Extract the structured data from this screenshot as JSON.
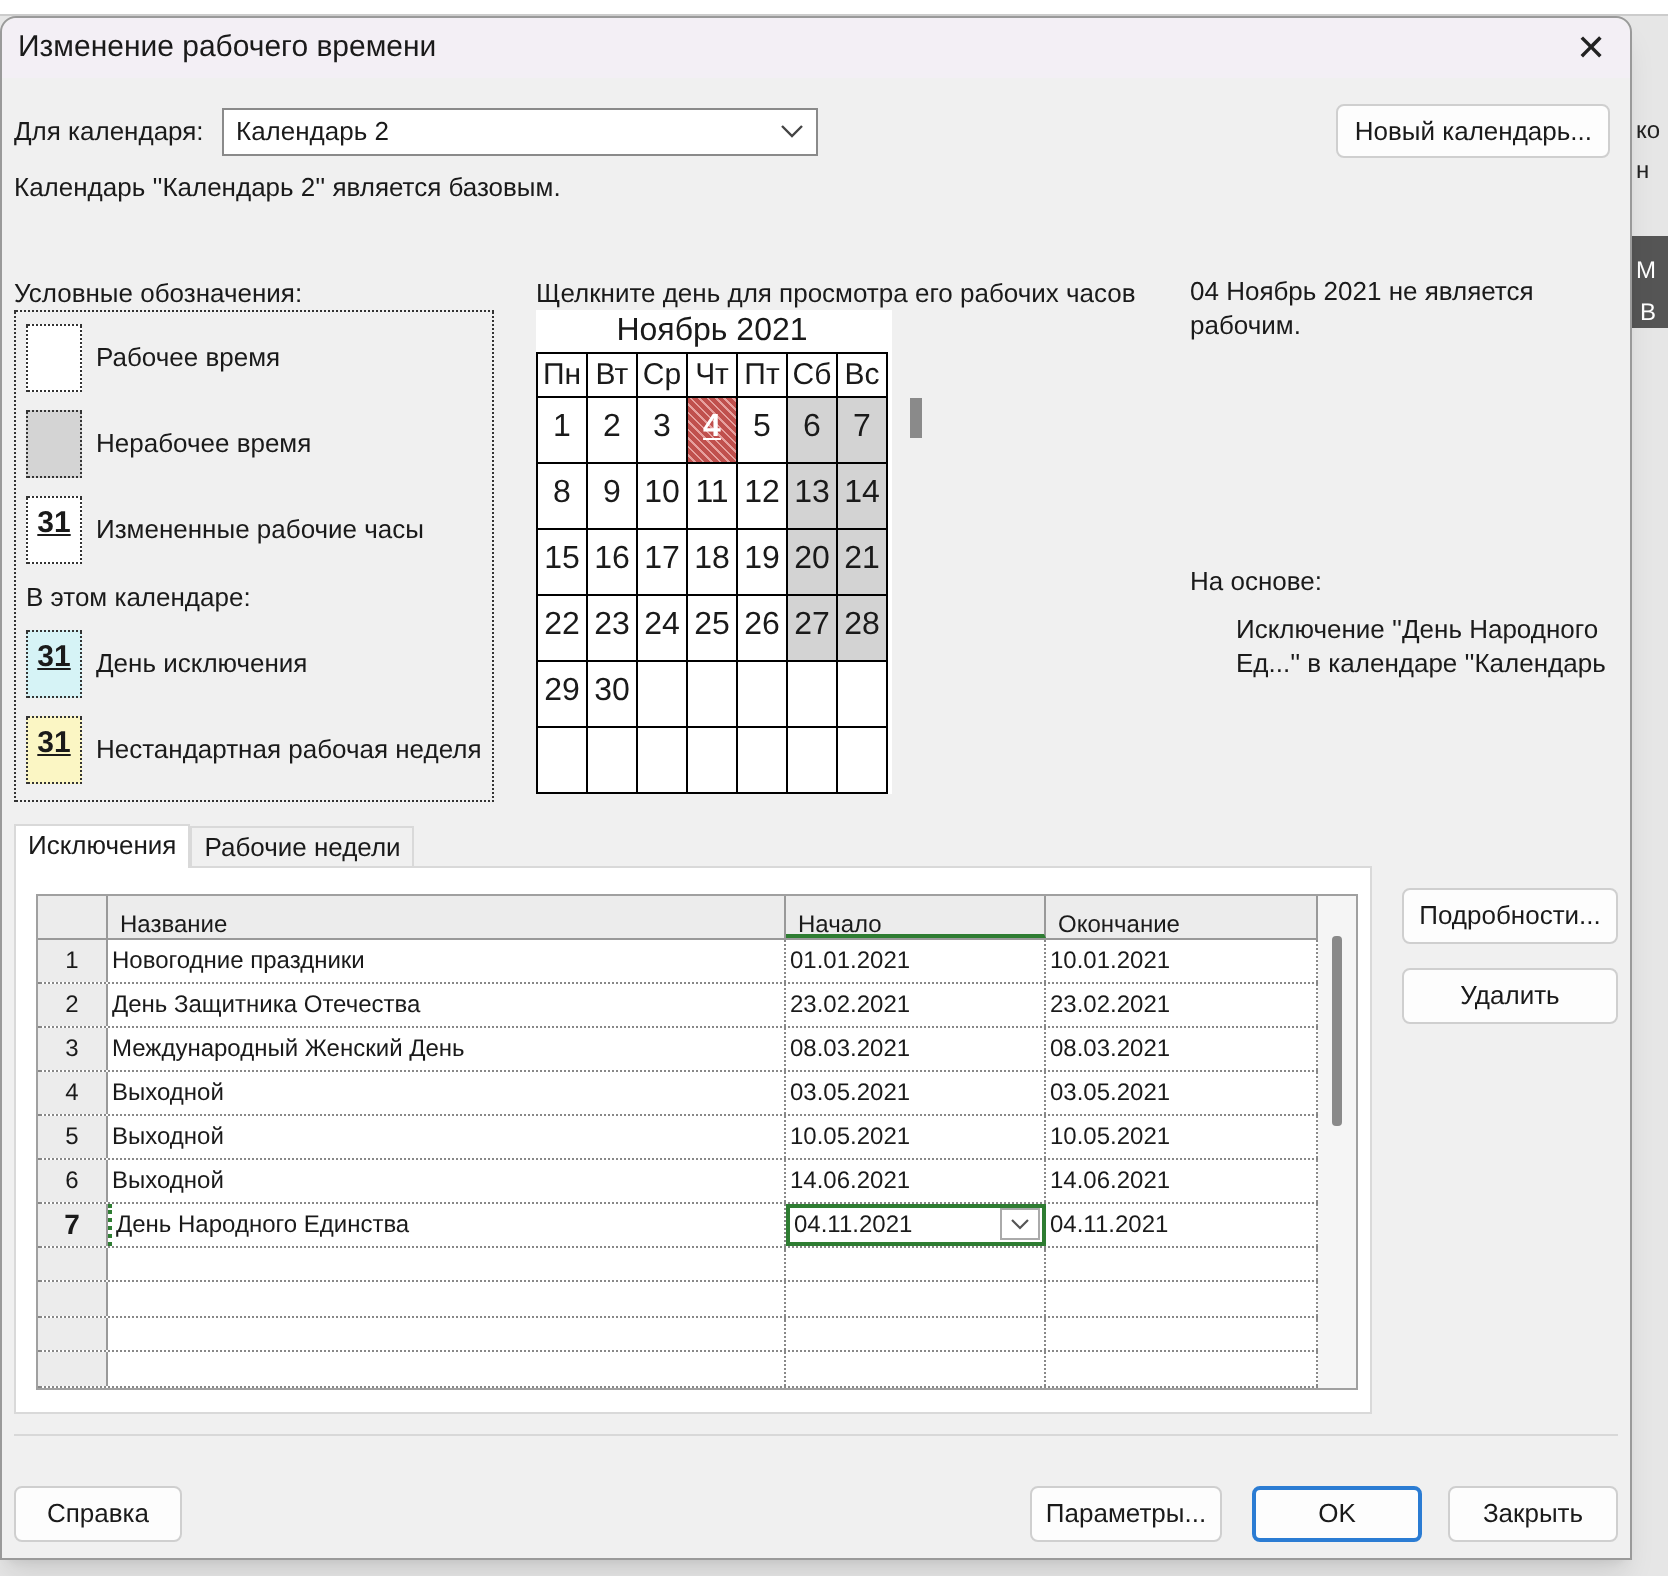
{
  "background_app": {
    "fragments": [
      {
        "text": "ко",
        "kind": "right"
      },
      {
        "text": "н",
        "kind": "right"
      },
      {
        "text": "М",
        "kind": "dark"
      },
      {
        "text": "В",
        "kind": "dark"
      }
    ]
  },
  "window": {
    "title": "Изменение рабочего времени",
    "close": "✕"
  },
  "calendar_select": {
    "label": "Для календаря:",
    "value": "Календарь 2"
  },
  "new_calendar_button": "Новый календарь...",
  "base_note": "Календарь ''Календарь 2'' является базовым.",
  "legend": {
    "title": "Условные обозначения:",
    "general": [
      {
        "kind": "working",
        "label": "Рабочее время"
      },
      {
        "kind": "nonworking",
        "label": "Нерабочее время"
      },
      {
        "kind": "changed",
        "sample": "31",
        "label": "Измененные рабочие часы"
      }
    ],
    "in_calendar_label": "В этом календаре:",
    "in_calendar": [
      {
        "kind": "exception",
        "sample": "31",
        "label": "День исключения"
      },
      {
        "kind": "nonstandard",
        "sample": "31",
        "label": "Нестандартная рабочая неделя"
      }
    ]
  },
  "calendar": {
    "hint": "Щелкните день для просмотра его рабочих часов",
    "month": "Ноябрь 2021",
    "weekdays": [
      "Пн",
      "Вт",
      "Ср",
      "Чт",
      "Пт",
      "Сб",
      "Вс"
    ],
    "days": [
      {
        "n": "1",
        "kind": "working",
        "selected": false
      },
      {
        "n": "2",
        "kind": "working",
        "selected": false
      },
      {
        "n": "3",
        "kind": "working",
        "selected": false
      },
      {
        "n": "4",
        "kind": "exception",
        "selected": true
      },
      {
        "n": "5",
        "kind": "working",
        "selected": false
      },
      {
        "n": "6",
        "kind": "nonworking",
        "selected": false
      },
      {
        "n": "7",
        "kind": "nonworking",
        "selected": false
      },
      {
        "n": "8",
        "kind": "working",
        "selected": false
      },
      {
        "n": "9",
        "kind": "working",
        "selected": false
      },
      {
        "n": "10",
        "kind": "working",
        "selected": false
      },
      {
        "n": "11",
        "kind": "working",
        "selected": false
      },
      {
        "n": "12",
        "kind": "working",
        "selected": false
      },
      {
        "n": "13",
        "kind": "nonworking",
        "selected": false
      },
      {
        "n": "14",
        "kind": "nonworking",
        "selected": false
      },
      {
        "n": "15",
        "kind": "working",
        "selected": false
      },
      {
        "n": "16",
        "kind": "working",
        "selected": false
      },
      {
        "n": "17",
        "kind": "working",
        "selected": false
      },
      {
        "n": "18",
        "kind": "working",
        "selected": false
      },
      {
        "n": "19",
        "kind": "working",
        "selected": false
      },
      {
        "n": "20",
        "kind": "nonworking",
        "selected": false
      },
      {
        "n": "21",
        "kind": "nonworking",
        "selected": false
      },
      {
        "n": "22",
        "kind": "working",
        "selected": false
      },
      {
        "n": "23",
        "kind": "working",
        "selected": false
      },
      {
        "n": "24",
        "kind": "working",
        "selected": false
      },
      {
        "n": "25",
        "kind": "working",
        "selected": false
      },
      {
        "n": "26",
        "kind": "working",
        "selected": false
      },
      {
        "n": "27",
        "kind": "nonworking",
        "selected": false
      },
      {
        "n": "28",
        "kind": "nonworking",
        "selected": false
      },
      {
        "n": "29",
        "kind": "working",
        "selected": false
      },
      {
        "n": "30",
        "kind": "working",
        "selected": false
      }
    ]
  },
  "day_info": {
    "status": "04 Ноябрь 2021 не является рабочим.",
    "based_on_label": "На основе:",
    "based_on": "Исключение ''День Народного Ед...'' в календаре ''Календарь"
  },
  "tabs": [
    {
      "label": "Исключения",
      "selected": true
    },
    {
      "label": "Рабочие недели",
      "selected": false
    }
  ],
  "table": {
    "columns": [
      "Название",
      "Начало",
      "Окончание"
    ],
    "rows": [
      {
        "num": "1",
        "name": "Новогодние праздники",
        "start": "01.01.2021",
        "end": "10.01.2021",
        "selected": false
      },
      {
        "num": "2",
        "name": "День Защитника Отечества",
        "start": "23.02.2021",
        "end": "23.02.2021",
        "selected": false
      },
      {
        "num": "3",
        "name": "Международный Женский День",
        "start": "08.03.2021",
        "end": "08.03.2021",
        "selected": false
      },
      {
        "num": "4",
        "name": "Выходной",
        "start": "03.05.2021",
        "end": "03.05.2021",
        "selected": false
      },
      {
        "num": "5",
        "name": "Выходной",
        "start": "10.05.2021",
        "end": "10.05.2021",
        "selected": false
      },
      {
        "num": "6",
        "name": "Выходной",
        "start": "14.06.2021",
        "end": "14.06.2021",
        "selected": false
      },
      {
        "num": "7",
        "name": "День Народного Единства",
        "start": "04.11.2021",
        "end": "04.11.2021",
        "selected": true
      }
    ]
  },
  "side_buttons": [
    "Подробности...",
    "Удалить"
  ],
  "footer_buttons": [
    {
      "label": "Справка",
      "kind": "plain"
    },
    {
      "label": "Параметры...",
      "kind": "plain"
    },
    {
      "label": "OK",
      "kind": "default"
    },
    {
      "label": "Закрыть",
      "kind": "plain"
    }
  ]
}
